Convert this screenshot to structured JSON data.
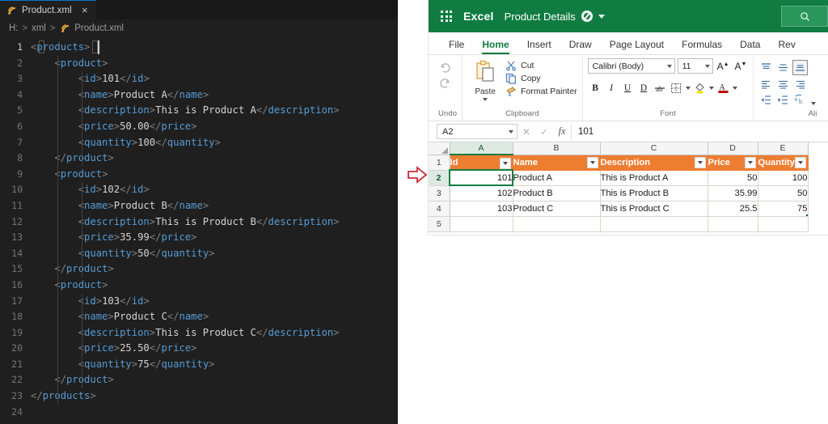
{
  "editor": {
    "tab": {
      "label": "Product.xml",
      "icon": "xml-file-icon",
      "close_icon": "×"
    },
    "breadcrumb": {
      "root": "H:",
      "folder": "xml",
      "file": "Product.xml",
      "separator": ">"
    },
    "lines": [
      {
        "n": "1",
        "indent": 0,
        "tokens": [
          [
            "br",
            "<"
          ],
          [
            "tag",
            "products"
          ],
          [
            "br",
            ">"
          ]
        ]
      },
      {
        "n": "2",
        "indent": 1,
        "tokens": [
          [
            "br",
            "<"
          ],
          [
            "tag",
            "product"
          ],
          [
            "br",
            ">"
          ]
        ]
      },
      {
        "n": "3",
        "indent": 2,
        "tokens": [
          [
            "br",
            "<"
          ],
          [
            "tag",
            "id"
          ],
          [
            "br",
            ">"
          ],
          [
            "txt",
            "101"
          ],
          [
            "br",
            "</"
          ],
          [
            "tag",
            "id"
          ],
          [
            "br",
            ">"
          ]
        ]
      },
      {
        "n": "4",
        "indent": 2,
        "tokens": [
          [
            "br",
            "<"
          ],
          [
            "tag",
            "name"
          ],
          [
            "br",
            ">"
          ],
          [
            "txt",
            "Product A"
          ],
          [
            "br",
            "</"
          ],
          [
            "tag",
            "name"
          ],
          [
            "br",
            ">"
          ]
        ]
      },
      {
        "n": "5",
        "indent": 2,
        "tokens": [
          [
            "br",
            "<"
          ],
          [
            "tag",
            "description"
          ],
          [
            "br",
            ">"
          ],
          [
            "txt",
            "This is Product A"
          ],
          [
            "br",
            "</"
          ],
          [
            "tag",
            "description"
          ],
          [
            "br",
            ">"
          ]
        ]
      },
      {
        "n": "6",
        "indent": 2,
        "tokens": [
          [
            "br",
            "<"
          ],
          [
            "tag",
            "price"
          ],
          [
            "br",
            ">"
          ],
          [
            "txt",
            "50.00"
          ],
          [
            "br",
            "</"
          ],
          [
            "tag",
            "price"
          ],
          [
            "br",
            ">"
          ]
        ]
      },
      {
        "n": "7",
        "indent": 2,
        "tokens": [
          [
            "br",
            "<"
          ],
          [
            "tag",
            "quantity"
          ],
          [
            "br",
            ">"
          ],
          [
            "txt",
            "100"
          ],
          [
            "br",
            "</"
          ],
          [
            "tag",
            "quantity"
          ],
          [
            "br",
            ">"
          ]
        ]
      },
      {
        "n": "8",
        "indent": 1,
        "tokens": [
          [
            "br",
            "</"
          ],
          [
            "tag",
            "product"
          ],
          [
            "br",
            ">"
          ]
        ]
      },
      {
        "n": "9",
        "indent": 1,
        "tokens": [
          [
            "br",
            "<"
          ],
          [
            "tag",
            "product"
          ],
          [
            "br",
            ">"
          ]
        ]
      },
      {
        "n": "10",
        "indent": 2,
        "tokens": [
          [
            "br",
            "<"
          ],
          [
            "tag",
            "id"
          ],
          [
            "br",
            ">"
          ],
          [
            "txt",
            "102"
          ],
          [
            "br",
            "</"
          ],
          [
            "tag",
            "id"
          ],
          [
            "br",
            ">"
          ]
        ]
      },
      {
        "n": "11",
        "indent": 2,
        "tokens": [
          [
            "br",
            "<"
          ],
          [
            "tag",
            "name"
          ],
          [
            "br",
            ">"
          ],
          [
            "txt",
            "Product B"
          ],
          [
            "br",
            "</"
          ],
          [
            "tag",
            "name"
          ],
          [
            "br",
            ">"
          ]
        ]
      },
      {
        "n": "12",
        "indent": 2,
        "tokens": [
          [
            "br",
            "<"
          ],
          [
            "tag",
            "description"
          ],
          [
            "br",
            ">"
          ],
          [
            "txt",
            "This is Product B"
          ],
          [
            "br",
            "</"
          ],
          [
            "tag",
            "description"
          ],
          [
            "br",
            ">"
          ]
        ]
      },
      {
        "n": "13",
        "indent": 2,
        "tokens": [
          [
            "br",
            "<"
          ],
          [
            "tag",
            "price"
          ],
          [
            "br",
            ">"
          ],
          [
            "txt",
            "35.99"
          ],
          [
            "br",
            "</"
          ],
          [
            "tag",
            "price"
          ],
          [
            "br",
            ">"
          ]
        ]
      },
      {
        "n": "14",
        "indent": 2,
        "tokens": [
          [
            "br",
            "<"
          ],
          [
            "tag",
            "quantity"
          ],
          [
            "br",
            ">"
          ],
          [
            "txt",
            "50"
          ],
          [
            "br",
            "</"
          ],
          [
            "tag",
            "quantity"
          ],
          [
            "br",
            ">"
          ]
        ]
      },
      {
        "n": "15",
        "indent": 1,
        "tokens": [
          [
            "br",
            "</"
          ],
          [
            "tag",
            "product"
          ],
          [
            "br",
            ">"
          ]
        ]
      },
      {
        "n": "16",
        "indent": 1,
        "tokens": [
          [
            "br",
            "<"
          ],
          [
            "tag",
            "product"
          ],
          [
            "br",
            ">"
          ]
        ]
      },
      {
        "n": "17",
        "indent": 2,
        "tokens": [
          [
            "br",
            "<"
          ],
          [
            "tag",
            "id"
          ],
          [
            "br",
            ">"
          ],
          [
            "txt",
            "103"
          ],
          [
            "br",
            "</"
          ],
          [
            "tag",
            "id"
          ],
          [
            "br",
            ">"
          ]
        ]
      },
      {
        "n": "18",
        "indent": 2,
        "tokens": [
          [
            "br",
            "<"
          ],
          [
            "tag",
            "name"
          ],
          [
            "br",
            ">"
          ],
          [
            "txt",
            "Product C"
          ],
          [
            "br",
            "</"
          ],
          [
            "tag",
            "name"
          ],
          [
            "br",
            ">"
          ]
        ]
      },
      {
        "n": "19",
        "indent": 2,
        "tokens": [
          [
            "br",
            "<"
          ],
          [
            "tag",
            "description"
          ],
          [
            "br",
            ">"
          ],
          [
            "txt",
            "This is Product C"
          ],
          [
            "br",
            "</"
          ],
          [
            "tag",
            "description"
          ],
          [
            "br",
            ">"
          ]
        ]
      },
      {
        "n": "20",
        "indent": 2,
        "tokens": [
          [
            "br",
            "<"
          ],
          [
            "tag",
            "price"
          ],
          [
            "br",
            ">"
          ],
          [
            "txt",
            "25.50"
          ],
          [
            "br",
            "</"
          ],
          [
            "tag",
            "price"
          ],
          [
            "br",
            ">"
          ]
        ]
      },
      {
        "n": "21",
        "indent": 2,
        "tokens": [
          [
            "br",
            "<"
          ],
          [
            "tag",
            "quantity"
          ],
          [
            "br",
            ">"
          ],
          [
            "txt",
            "75"
          ],
          [
            "br",
            "</"
          ],
          [
            "tag",
            "quantity"
          ],
          [
            "br",
            ">"
          ]
        ]
      },
      {
        "n": "22",
        "indent": 1,
        "tokens": [
          [
            "br",
            "</"
          ],
          [
            "tag",
            "product"
          ],
          [
            "br",
            ">"
          ]
        ]
      },
      {
        "n": "23",
        "indent": 0,
        "tokens": [
          [
            "br",
            "</"
          ],
          [
            "tag",
            "products"
          ],
          [
            "br",
            ">"
          ]
        ]
      },
      {
        "n": "24",
        "indent": 0,
        "tokens": []
      }
    ]
  },
  "excel": {
    "titlebar": {
      "app_name": "Excel",
      "document_name": "Product Details",
      "waffle_icon": "app-launcher-icon",
      "autosave_icon": "autosave-cloud-icon",
      "chevron_icon": "chevron-down-icon",
      "search_icon": "search-icon"
    },
    "ribbon_tabs": [
      {
        "label": "File",
        "active": false
      },
      {
        "label": "Home",
        "active": true
      },
      {
        "label": "Insert",
        "active": false
      },
      {
        "label": "Draw",
        "active": false
      },
      {
        "label": "Page Layout",
        "active": false
      },
      {
        "label": "Formulas",
        "active": false
      },
      {
        "label": "Data",
        "active": false
      },
      {
        "label": "Rev",
        "active": false
      }
    ],
    "undo_group": {
      "label": "Undo",
      "undo_icon": "undo-arrow-icon",
      "redo_icon": "redo-arrow-icon"
    },
    "clipboard_group": {
      "label": "Clipboard",
      "paste_label": "Paste",
      "paste_icon": "clipboard-icon",
      "items": [
        {
          "label": "Cut",
          "icon": "scissors-icon"
        },
        {
          "label": "Copy",
          "icon": "copy-icon"
        },
        {
          "label": "Format Painter",
          "icon": "format-painter-icon"
        }
      ]
    },
    "font_group": {
      "label": "Font",
      "font_name": "Calibri (Body)",
      "font_size": "11",
      "grow_font_label": "A",
      "shrink_font_label": "A",
      "bold_label": "B",
      "italic_label": "I",
      "underline_label": "U",
      "double_underline_label": "D",
      "strikethrough_icon": "strikethrough-icon",
      "borders_icon": "borders-icon",
      "fill_color_icon": "fill-color-icon",
      "font_color_icon": "font-color-icon"
    },
    "alignment_group": {
      "label": "Ali",
      "buttons": [
        "align-top-icon",
        "align-middle-icon",
        "align-bottom-icon",
        "align-left-icon",
        "align-center-icon",
        "align-right-icon",
        "decrease-indent-icon",
        "increase-indent-icon",
        "orientation-icon"
      ]
    },
    "formula_bar": {
      "name_box": "A2",
      "cancel_icon": "cancel-icon",
      "confirm_icon": "confirm-icon",
      "function_icon": "fx",
      "value": "101"
    },
    "sheet": {
      "columns": [
        {
          "letter": "A",
          "width": 78,
          "active": true
        },
        {
          "letter": "B",
          "width": 108,
          "active": false
        },
        {
          "letter": "C",
          "width": 133,
          "active": false
        },
        {
          "letter": "D",
          "width": 62,
          "active": false
        },
        {
          "letter": "E",
          "width": 62,
          "active": false
        }
      ],
      "header_row": {
        "number": "1",
        "cells": [
          "Id",
          "Name",
          "Description",
          "Price",
          "Quantity"
        ]
      },
      "rows": [
        {
          "number": "2",
          "cells": [
            "101",
            "Product A",
            "This is Product A",
            "50",
            "100"
          ],
          "selected_col": 0
        },
        {
          "number": "3",
          "cells": [
            "102",
            "Product B",
            "This is Product B",
            "35.99",
            "50"
          ],
          "selected_col": -1
        },
        {
          "number": "4",
          "cells": [
            "103",
            "Product C",
            "This is Product C",
            "25.5",
            "75"
          ],
          "selected_col": -1
        },
        {
          "number": "5",
          "cells": [
            "",
            "",
            "",
            "",
            ""
          ],
          "selected_col": -1
        }
      ],
      "table_header_color": "#ed7d31",
      "selection_color": "#137e43",
      "filter_icon": "filter-dropdown-icon"
    }
  },
  "annotation": {
    "arrow_icon": "red-right-arrow",
    "arrow_color": "#cc2b3c"
  }
}
